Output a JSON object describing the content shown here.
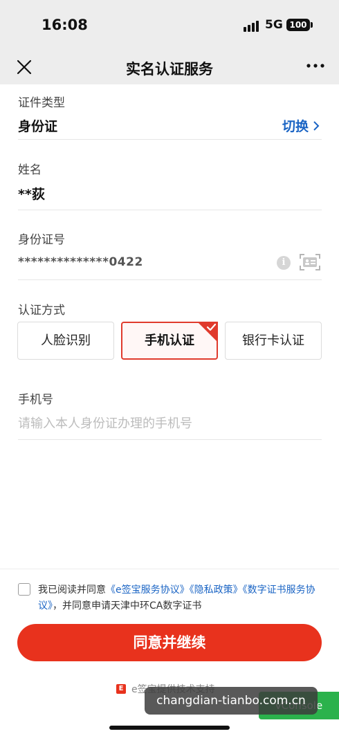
{
  "status_bar": {
    "time": "16:08",
    "network": "5G",
    "battery": "100"
  },
  "nav": {
    "title": "实名认证服务"
  },
  "form": {
    "cert_type": {
      "label": "证件类型",
      "value": "身份证",
      "switch_label": "切换"
    },
    "name": {
      "label": "姓名",
      "value": "**荻"
    },
    "id_number": {
      "label": "身份证号",
      "value": "**************0422"
    },
    "auth_method": {
      "label": "认证方式",
      "options": [
        "人脸识别",
        "手机认证",
        "银行卡认证"
      ],
      "selected": "手机认证"
    },
    "phone": {
      "label": "手机号",
      "placeholder": "请输入本人身份证办理的手机号"
    }
  },
  "agreement": {
    "prefix": "我已阅读并同意",
    "link1": "《e签宝服务协议》",
    "link2": "《隐私政策》",
    "link3": "《数字证书服务协议》",
    "suffix": "，并同意申请天津中环CA数字证书"
  },
  "continue_button": "同意并继续",
  "powered_by": "e签宝提供技术支持",
  "vconsole_label": "vConsole",
  "watermark": "changdian-tianbo.com.cn",
  "colors": {
    "accent": "#e8321d",
    "link": "#1a64c4",
    "vconsole": "#2bb24c"
  }
}
